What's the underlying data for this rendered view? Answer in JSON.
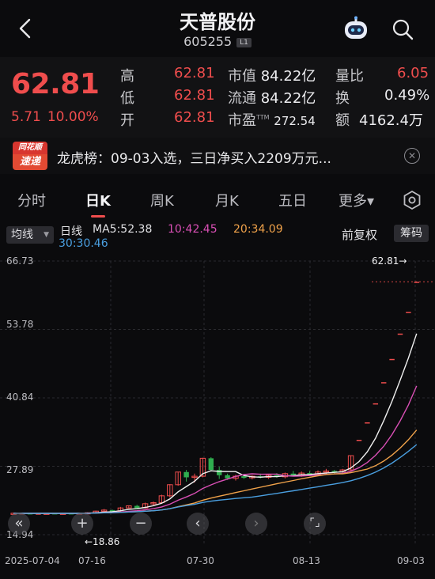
{
  "header": {
    "title": "天普股份",
    "code": "605255",
    "tag": "L1"
  },
  "quote": {
    "price": "62.81",
    "change": "5.71",
    "change_pct": "10.00%",
    "high_label": "高",
    "high": "62.81",
    "low_label": "低",
    "low": "62.81",
    "open_label": "开",
    "open": "62.81",
    "mktcap_label": "市值",
    "mktcap": "84.22亿",
    "float_label": "流通",
    "float": "84.22亿",
    "pe_label": "市盈",
    "pe_sup": "TTM",
    "pe": "272.54",
    "volratio_label": "量比",
    "volratio": "6.05",
    "turnover_label": "换",
    "turnover": "0.49%",
    "amount_label": "额",
    "amount": "4162.4万"
  },
  "lhb": {
    "badge_top": "同花顺",
    "badge_bottom": "速递",
    "text": "龙虎榜：09-03入选，三日净买入2209万元..."
  },
  "tabs": [
    "分时",
    "日K",
    "周K",
    "月K",
    "五日",
    "更多▾"
  ],
  "active_tab": "日K",
  "ma_bar": {
    "selector": "均线",
    "label": "日线",
    "ma5": "MA5:52.38",
    "ma10": "10:42.45",
    "ma20": "20:34.09",
    "ma30": "30:30.46",
    "adjust": "前复权",
    "chip": "筹码"
  },
  "colors": {
    "up": "#ef4d4d",
    "down": "#2fae4f",
    "ma5": "#f0f0f0",
    "ma10": "#d94fb5",
    "ma20": "#f0a24a",
    "ma30": "#4a9fe0"
  },
  "chart_data": {
    "type": "candlestick",
    "y_ticks": [
      "66.73",
      "53.78",
      "40.84",
      "27.89",
      "14.94"
    ],
    "ylim": [
      14.94,
      66.73
    ],
    "x_ticks": [
      "2025-07-04",
      "07-16",
      "07-30",
      "08-13",
      "09-03"
    ],
    "high_marker": "62.81→",
    "low_marker": "←18.86",
    "candles": [
      [
        18.9,
        19.1,
        18.86,
        19.0
      ],
      [
        19.0,
        19.1,
        18.9,
        19.0
      ],
      [
        19.0,
        19.05,
        18.9,
        18.95
      ],
      [
        18.95,
        19.0,
        18.9,
        18.95
      ],
      [
        18.95,
        19.0,
        18.9,
        19.0
      ],
      [
        19.0,
        19.05,
        18.9,
        18.95
      ],
      [
        18.95,
        19.0,
        18.9,
        19.0
      ],
      [
        19.0,
        19.05,
        18.9,
        18.95
      ],
      [
        18.95,
        19.1,
        18.9,
        19.05
      ],
      [
        19.05,
        19.2,
        19.0,
        19.1
      ],
      [
        19.1,
        19.5,
        19.0,
        19.4
      ],
      [
        19.4,
        19.8,
        19.3,
        19.6
      ],
      [
        19.6,
        19.7,
        19.2,
        19.3
      ],
      [
        19.3,
        20.2,
        19.2,
        20.0
      ],
      [
        20.0,
        20.5,
        19.9,
        20.4
      ],
      [
        20.4,
        20.6,
        19.9,
        20.0
      ],
      [
        20.0,
        21.0,
        19.9,
        20.8
      ],
      [
        20.8,
        21.2,
        20.5,
        21.0
      ],
      [
        21.0,
        22.5,
        20.8,
        22.3
      ],
      [
        22.3,
        24.5,
        22.0,
        24.4
      ],
      [
        24.4,
        26.8,
        24.2,
        26.8
      ],
      [
        26.8,
        27.2,
        25.0,
        25.8
      ],
      [
        25.8,
        26.5,
        24.8,
        26.0
      ],
      [
        26.0,
        29.5,
        25.8,
        29.4
      ],
      [
        29.4,
        29.6,
        27.0,
        27.2
      ],
      [
        27.2,
        27.8,
        25.5,
        26.2
      ],
      [
        26.2,
        26.5,
        25.3,
        25.6
      ],
      [
        25.6,
        26.3,
        25.2,
        26.0
      ],
      [
        26.0,
        26.4,
        25.5,
        25.7
      ],
      [
        25.7,
        26.2,
        25.4,
        26.0
      ],
      [
        26.0,
        26.5,
        25.6,
        25.8
      ],
      [
        25.8,
        26.4,
        25.5,
        26.2
      ],
      [
        26.2,
        26.6,
        25.7,
        25.9
      ],
      [
        25.9,
        26.7,
        25.6,
        26.5
      ],
      [
        26.5,
        27.0,
        26.0,
        26.2
      ],
      [
        26.2,
        26.9,
        25.9,
        26.6
      ],
      [
        26.6,
        27.0,
        26.2,
        26.4
      ],
      [
        26.4,
        27.1,
        26.1,
        26.8
      ],
      [
        26.8,
        27.4,
        26.4,
        27.0
      ],
      [
        27.0,
        27.2,
        26.5,
        26.9
      ],
      [
        26.9,
        27.4,
        26.6,
        27.2
      ],
      [
        27.2,
        29.9,
        27.0,
        29.9
      ],
      [
        32.9,
        32.9,
        32.9,
        32.9
      ],
      [
        36.2,
        36.2,
        36.2,
        36.2
      ],
      [
        39.8,
        39.8,
        39.8,
        39.8
      ],
      [
        43.8,
        43.8,
        43.8,
        43.8
      ],
      [
        48.2,
        48.2,
        48.2,
        48.2
      ],
      [
        53.0,
        53.0,
        53.0,
        53.0
      ],
      [
        57.1,
        57.1,
        57.1,
        57.1
      ],
      [
        62.81,
        62.81,
        62.81,
        62.81
      ]
    ]
  }
}
